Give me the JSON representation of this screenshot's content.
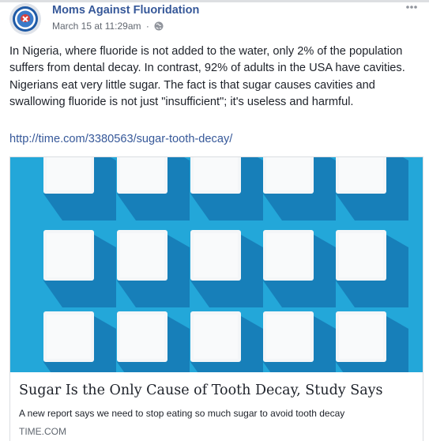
{
  "post": {
    "page_name": "Moms Against Fluoridation",
    "timestamp": "March 15 at 11:29am",
    "separator": "·",
    "privacy_icon": "globe-icon",
    "more_icon": "more-options-icon",
    "body_text": "In Nigeria, where fluoride is not added to the water, only 2% of the population suffers from dental decay. In contrast, 92% of adults in the USA have cavities. Nigerians eat very little sugar. The fact is that sugar causes cavities and swallowing fluoride is not just \"insufficient\"; it's useless and harmful.",
    "link_url": "http://time.com/3380563/sugar-tooth-decay/"
  },
  "link_card": {
    "image_icon": "sugar-cubes-image",
    "title": "Sugar Is the Only Cause of Tooth Decay, Study Says",
    "description": "A new report says we need to stop eating so much sugar to avoid tooth decay",
    "domain": "TIME.COM"
  },
  "colors": {
    "link": "#365899",
    "text": "#1d2129",
    "meta": "#616770",
    "image_background": "#23a7d9",
    "sugar_cube": "#f4f6f8"
  }
}
